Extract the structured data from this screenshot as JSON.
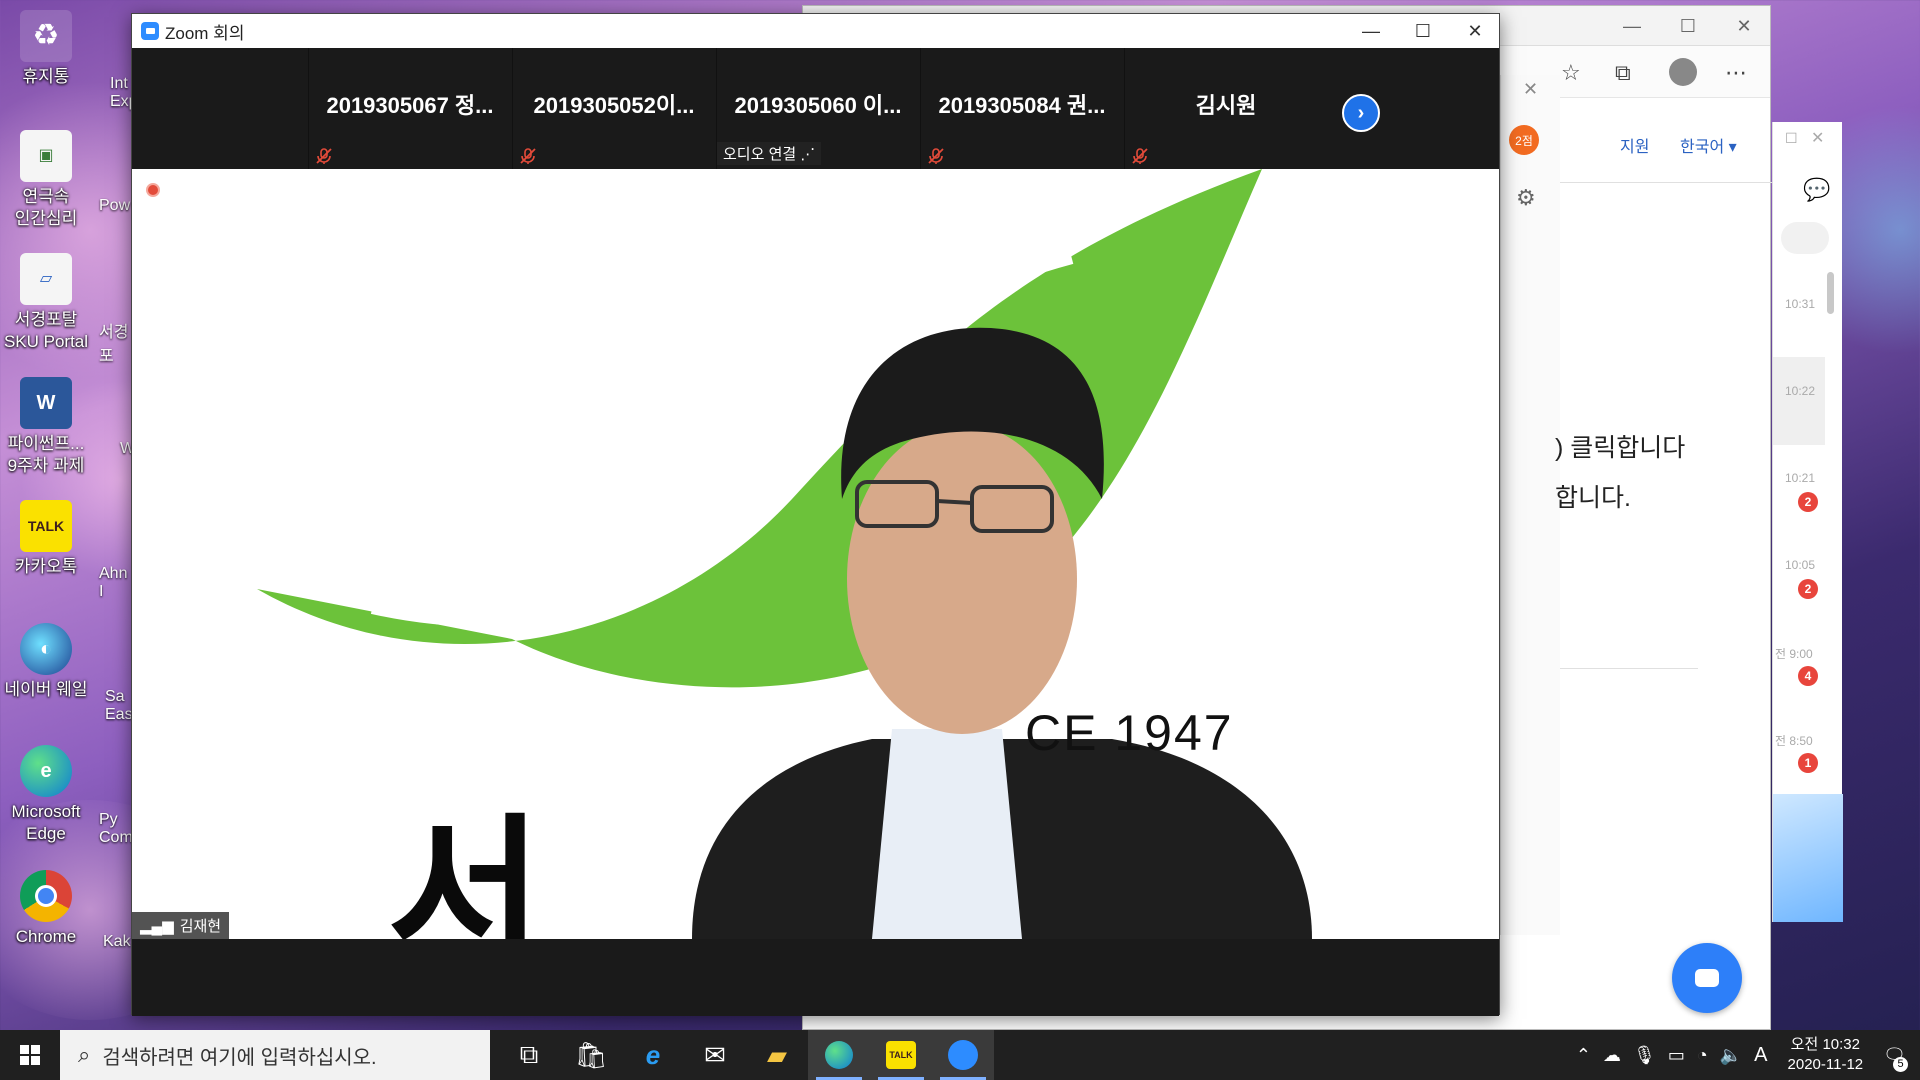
{
  "desktop": {
    "icons": [
      {
        "label": "휴지통"
      },
      {
        "label": "연극속\n인간심리"
      },
      {
        "label": "서경포탈\nSKU Portal"
      },
      {
        "label": "파이썬프...\n9주차 과제"
      },
      {
        "label": "카카오톡"
      },
      {
        "label": "네이버 웨일"
      },
      {
        "label": "Microsoft\nEdge"
      },
      {
        "label": "Chrome"
      }
    ],
    "partial_labels": [
      "Int\nExp",
      "Pow",
      "서경\n포",
      "W",
      "Ahn\nI",
      "Sa\nEas",
      "Py\nCom",
      "Kak"
    ]
  },
  "zoom": {
    "title": "Zoom 회의",
    "participants": [
      {
        "name": "2019305067 정...",
        "muted": true
      },
      {
        "name": "2019305052이...",
        "muted": true
      },
      {
        "name": "2019305060 이...",
        "audio_label": "오디오 연결"
      },
      {
        "name": "2019305084 권...",
        "muted": true
      },
      {
        "name": "김시원",
        "muted": true
      }
    ],
    "speaker_name": "김재현",
    "video_text": {
      "since": "CE 1947",
      "hangul": "서"
    },
    "colors": {
      "accent": "#2d8cff",
      "leaf_green": "#6cc23a",
      "record": "#e34b3a"
    }
  },
  "browser": {
    "side_badge": "2점",
    "help_links": [
      "지원",
      "한국어"
    ],
    "help_text_line1": ") 클릭합니다",
    "help_text_line2": "합니다.",
    "chat_times": [
      "10:31",
      "10:22",
      "10:21",
      "10:05",
      "전 9:00",
      "전 8:50"
    ],
    "chat_badges": [
      "2",
      "2",
      "4",
      "1"
    ]
  },
  "taskbar": {
    "search_placeholder": "검색하려면 여기에 입력하십시오.",
    "clock_time": "오전 10:32",
    "clock_date": "2020-11-12",
    "ime": "A",
    "notification_count": "5"
  }
}
